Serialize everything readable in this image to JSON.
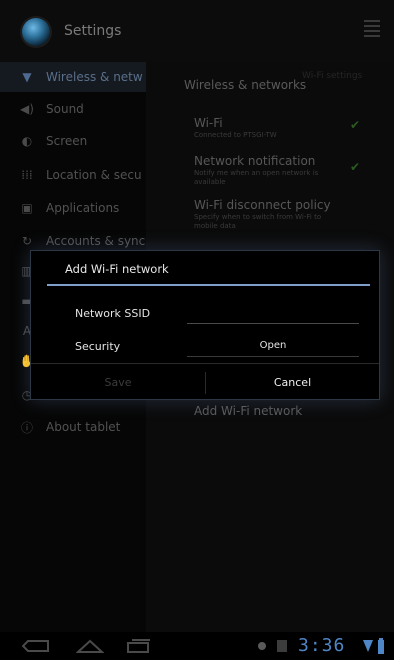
{
  "app": {
    "title": "Settings"
  },
  "sidebar": {
    "items": [
      {
        "label": "Wireless & netw",
        "icon": "wifi-icon",
        "glyph": "▼",
        "selected": true
      },
      {
        "label": "Sound",
        "icon": "speaker-icon",
        "glyph": "◀)"
      },
      {
        "label": "Screen",
        "icon": "brightness-icon",
        "glyph": "◐"
      },
      {
        "label": "Location & secu",
        "icon": "grid-icon",
        "glyph": "⁞⁞⁞"
      },
      {
        "label": "Applications",
        "icon": "applications-icon",
        "glyph": "▣"
      },
      {
        "label": "Accounts & sync",
        "icon": "sync-icon",
        "glyph": "↻"
      },
      {
        "label": "",
        "icon": "privacy-icon",
        "glyph": "▥"
      },
      {
        "label": "",
        "icon": "storage-icon",
        "glyph": "▬"
      },
      {
        "label": "",
        "icon": "language-icon",
        "glyph": "A"
      },
      {
        "label": "",
        "icon": "accessibility-icon",
        "glyph": "✋"
      },
      {
        "label": "",
        "icon": "date-time-icon",
        "glyph": "◷"
      },
      {
        "label": "About tablet",
        "icon": "info-icon",
        "glyph": "ⓘ"
      }
    ]
  },
  "panel": {
    "header": "Wireless & networks",
    "header_aside": "Wi-Fi settings",
    "prefs": [
      {
        "title": "Wi-Fi",
        "summary": "Connected to PTSGI-TW",
        "checked": true
      },
      {
        "title": "Network notification",
        "summary": "Notify me when an open network is available",
        "checked": true
      },
      {
        "title": "Wi-Fi disconnect policy",
        "summary": "Specify when to switch from Wi-Fi to mobile data"
      }
    ],
    "add_network": "Add Wi-Fi network"
  },
  "dialog": {
    "title": "Add Wi-Fi network",
    "ssid_label": "Network SSID",
    "ssid_value": "",
    "security_label": "Security",
    "security_value": "Open",
    "save_label": "Save",
    "cancel_label": "Cancel"
  },
  "status": {
    "time": "3:36"
  },
  "colors": {
    "accent": "#7e9fc9",
    "clock": "#4e86c8",
    "check": "#2d5a22"
  }
}
